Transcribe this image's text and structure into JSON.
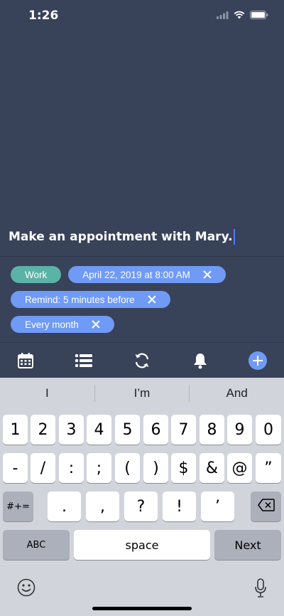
{
  "status": {
    "time": "1:26",
    "icons": [
      "signal-icon",
      "wifi-icon",
      "battery-icon"
    ]
  },
  "task": {
    "text": "Make an appointment with Mary."
  },
  "tags": {
    "category": "Work",
    "date": "April 22, 2019 at 8:00 AM",
    "reminder": "Remind: 5 minutes before",
    "repeat": "Every month"
  },
  "toolbar": {
    "icons": [
      "calendar-icon",
      "list-icon",
      "repeat-icon",
      "bell-icon",
      "add-icon"
    ]
  },
  "keyboard": {
    "suggestions": [
      "I",
      "I’m",
      "And"
    ],
    "row1": [
      "1",
      "2",
      "3",
      "4",
      "5",
      "6",
      "7",
      "8",
      "9",
      "0"
    ],
    "row2": [
      "-",
      "/",
      ":",
      ";",
      "(",
      ")",
      "$",
      "&",
      "@",
      "”"
    ],
    "row3": [
      ".",
      ",",
      "?",
      "!",
      "’"
    ],
    "symbols_key": "#+=",
    "abc_key": "ABC",
    "space_key": "space",
    "next_key": "Next"
  },
  "colors": {
    "background": "#384259",
    "teal_tag": "#5bb2a6",
    "blue_tag": "#6f9af5",
    "accent": "#4f7df2"
  }
}
